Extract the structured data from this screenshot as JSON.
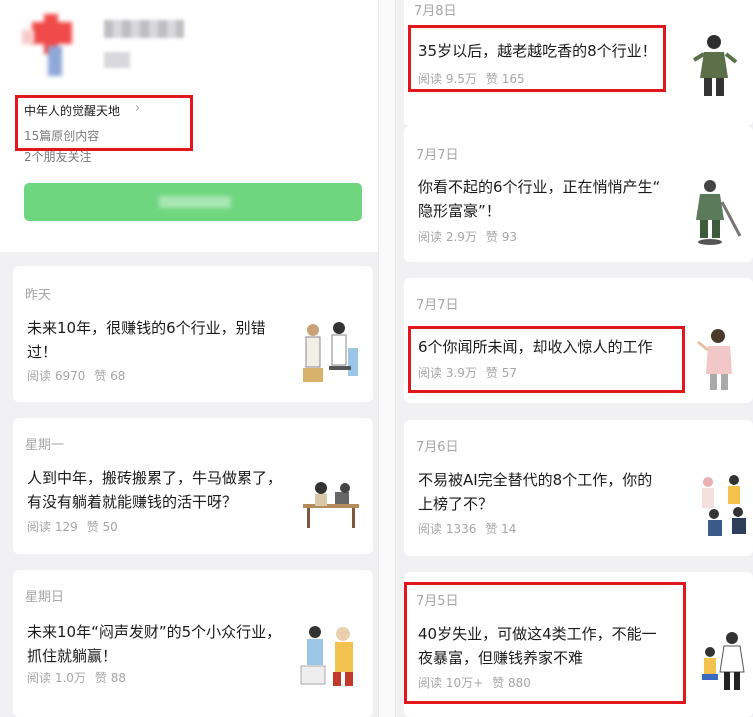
{
  "profile": {
    "account_name": "中年人的觉醒天地",
    "original_count": "15篇原创内容",
    "friends_following": "2个朋友关注",
    "chevron": "›"
  },
  "left_articles": [
    {
      "date": "昨天",
      "title_line1": "未来10年，很赚钱的6个行业，别错",
      "title_line2": "过！",
      "reads": "阅读 6970",
      "likes": "赞 68"
    },
    {
      "date": "星期一",
      "title_line1": "人到中年，搬砖搬累了，牛马做累了，",
      "title_line2": "有没有躺着就能赚钱的活干呀？",
      "reads": "阅读 129",
      "likes": "赞 50"
    },
    {
      "date": "星期日",
      "title_line1": "未来10年“闷声发财”的5个小众行业，",
      "title_line2": "抓住就躺赢！",
      "reads": "阅读 1.0万",
      "likes": "赞 88"
    }
  ],
  "right_articles": [
    {
      "date": "7月8日",
      "title_line1": "35岁以后，越老越吃香的8个行业！",
      "title_line2": "",
      "reads": "阅读 9.5万",
      "likes": "赞 165"
    },
    {
      "date": "7月7日",
      "title_line1": "你看不起的6个行业，正在悄悄产生“",
      "title_line2": "隐形富豪”！",
      "reads": "阅读 2.9万",
      "likes": "赞 93"
    },
    {
      "date": "7月7日",
      "title_line1": "6个你闻所未闻，却收入惊人的工作",
      "title_line2": "",
      "reads": "阅读 3.9万",
      "likes": "赞 57"
    },
    {
      "date": "7月6日",
      "title_line1": "不易被AI完全替代的8个工作，你的",
      "title_line2": "上榜了不？",
      "reads": "阅读 1336",
      "likes": "赞 14"
    },
    {
      "date": "7月5日",
      "title_line1": "40岁失业，可做这4类工作，不能一",
      "title_line2": "夜暴富，但赚钱养家不难",
      "reads": "阅读 10万+",
      "likes": "赞 880"
    }
  ],
  "colors": {
    "highlight": "#e2161c",
    "follow_button": "#6fd680",
    "meta_text": "#a6a6a6"
  }
}
